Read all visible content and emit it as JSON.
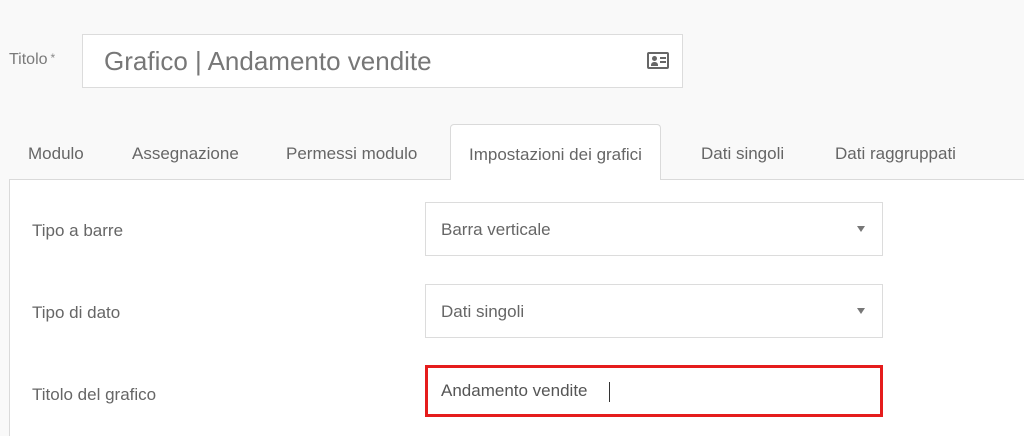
{
  "title": {
    "label": "Titolo",
    "required_mark": "*",
    "value": "Grafico | Andamento vendite",
    "icon": "id-card-icon"
  },
  "tabs": [
    {
      "label": "Modulo",
      "active": false
    },
    {
      "label": "Assegnazione",
      "active": false
    },
    {
      "label": "Permessi modulo",
      "active": false
    },
    {
      "label": "Impostazioni dei grafici",
      "active": true
    },
    {
      "label": "Dati singoli",
      "active": false
    },
    {
      "label": "Dati raggruppati",
      "active": false
    }
  ],
  "settings": {
    "bar_type": {
      "label": "Tipo a barre",
      "value": "Barra verticale"
    },
    "data_type": {
      "label": "Tipo di dato",
      "value": "Dati singoli"
    },
    "chart_title": {
      "label": "Titolo del grafico",
      "value": "Andamento vendite"
    }
  },
  "colors": {
    "highlight_border": "#e51c1c",
    "background": "#f9f9f9",
    "border": "#dadada"
  }
}
